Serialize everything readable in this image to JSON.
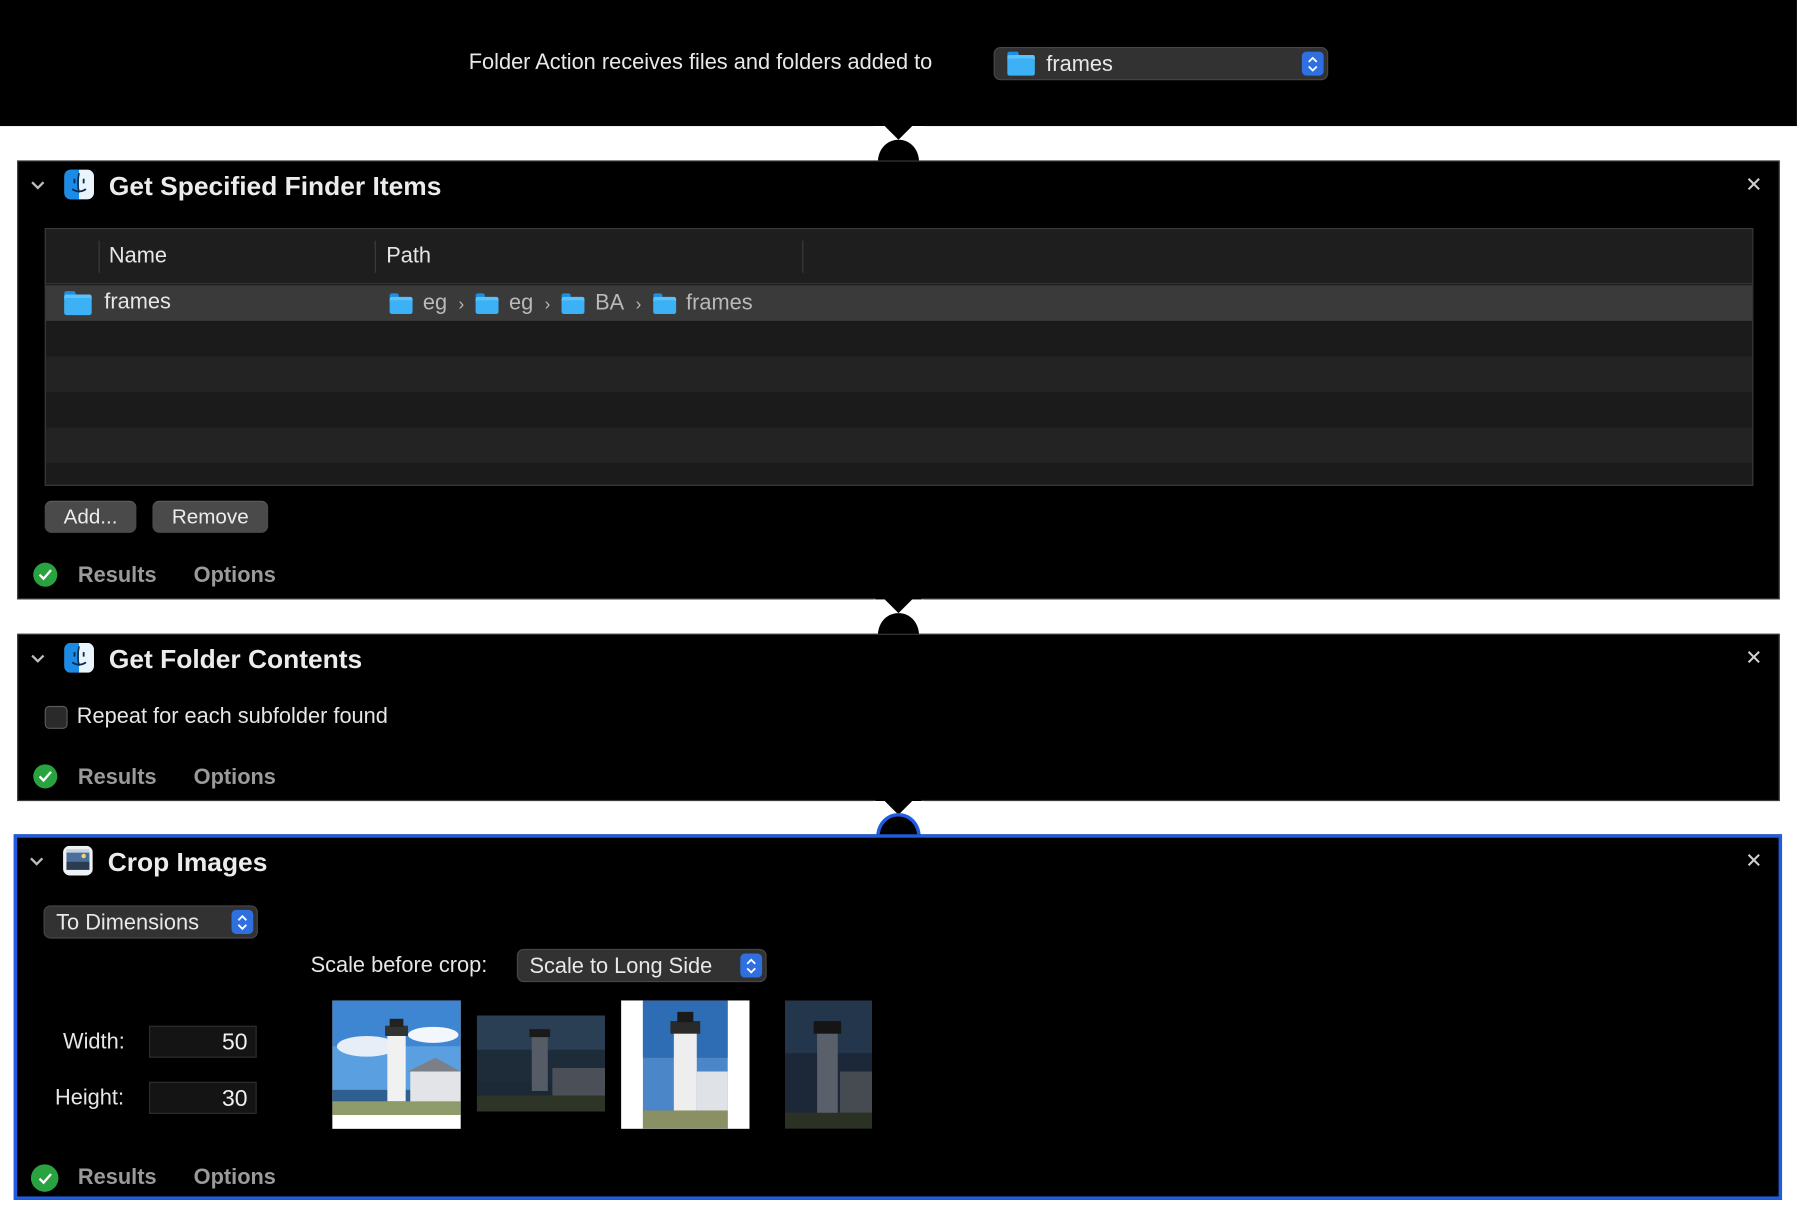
{
  "header": {
    "caption": "Folder Action receives files and folders added to",
    "folder_popup": "frames"
  },
  "actions": [
    {
      "title": "Get Specified Finder Items",
      "table": {
        "columns": [
          "Name",
          "Path"
        ],
        "rows": [
          {
            "name": "frames",
            "path": [
              "eg",
              "eg",
              "BA",
              "frames"
            ]
          }
        ]
      },
      "buttons": {
        "add": "Add...",
        "remove": "Remove"
      },
      "tabs": {
        "results": "Results",
        "options": "Options"
      }
    },
    {
      "title": "Get Folder Contents",
      "checkbox_label": "Repeat for each subfolder found",
      "checkbox_checked": false,
      "tabs": {
        "results": "Results",
        "options": "Options"
      }
    },
    {
      "title": "Crop Images",
      "mode_popup": "To Dimensions",
      "scale_label": "Scale before crop:",
      "scale_popup": "Scale to Long Side",
      "width_label": "Width:",
      "width_value": "50",
      "height_label": "Height:",
      "height_value": "30",
      "tabs": {
        "results": "Results",
        "options": "Options"
      }
    }
  ],
  "icons": {
    "close": "close-icon",
    "disclosure": "chevron-down-icon",
    "finder": "finder-icon",
    "preview": "preview-icon",
    "folder": "folder-icon",
    "home_folder": "home-folder-icon",
    "status": "checkmark-icon"
  },
  "colors": {
    "accent": "#1f5ce0",
    "popup_arrows": "#2f6fe0",
    "status_ok": "#29a33f",
    "folder": "#3db1f5"
  }
}
